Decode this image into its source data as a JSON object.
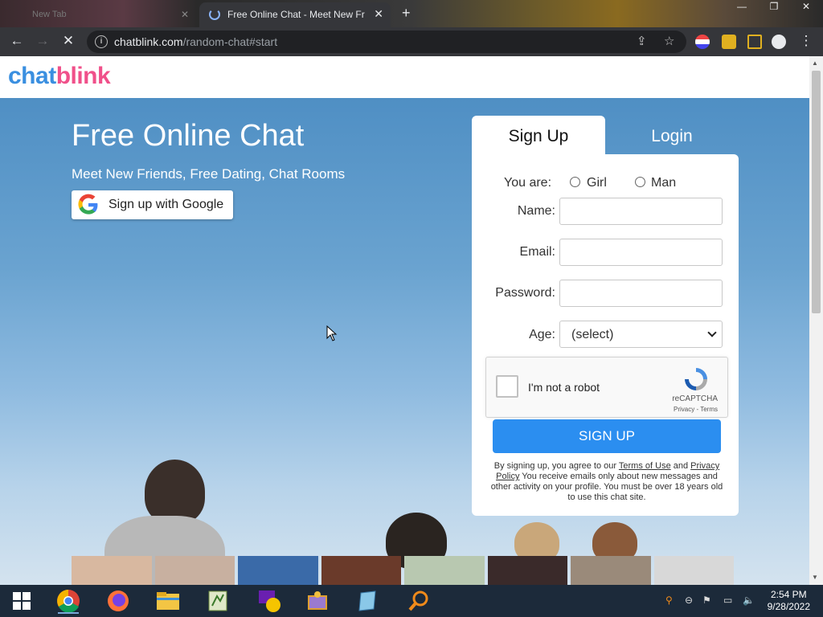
{
  "browser": {
    "prev_tab_title": "New Tab",
    "active_tab_title": "Free Online Chat - Meet New Fr",
    "url_host": "chatblink.com",
    "url_path": "/random-chat#start"
  },
  "site": {
    "logo_part1": "chat",
    "logo_part2": "blink",
    "hero_title": "Free Online Chat",
    "hero_subtitle": "Meet New Friends, Free Dating, Chat Rooms",
    "google_button": "Sign up with Google"
  },
  "form": {
    "tab_signup": "Sign Up",
    "tab_login": "Login",
    "you_are_label": "You are:",
    "gender_options": [
      "Girl",
      "Man"
    ],
    "name_label": "Name:",
    "email_label": "Email:",
    "password_label": "Password:",
    "age_label": "Age:",
    "age_select_value": "(select)",
    "captcha_text": "I'm not a robot",
    "captcha_brand": "reCAPTCHA",
    "captcha_terms": "Privacy - Terms",
    "submit_label": "SIGN UP",
    "terms_prefix": "By signing up, you agree to our ",
    "terms_link": "Terms of Use",
    "terms_and": " and ",
    "privacy_link": "Privacy Policy",
    "terms_suffix": " You receive emails only about new messages and other activity on your profile. You must be over 18 years old to use this chat site."
  },
  "taskbar": {
    "time": "2:54 PM",
    "date": "9/28/2022"
  },
  "colors": {
    "brand_blue": "#3a8fe0",
    "brand_pink": "#f0508a",
    "button_blue": "#2b8ef0"
  }
}
